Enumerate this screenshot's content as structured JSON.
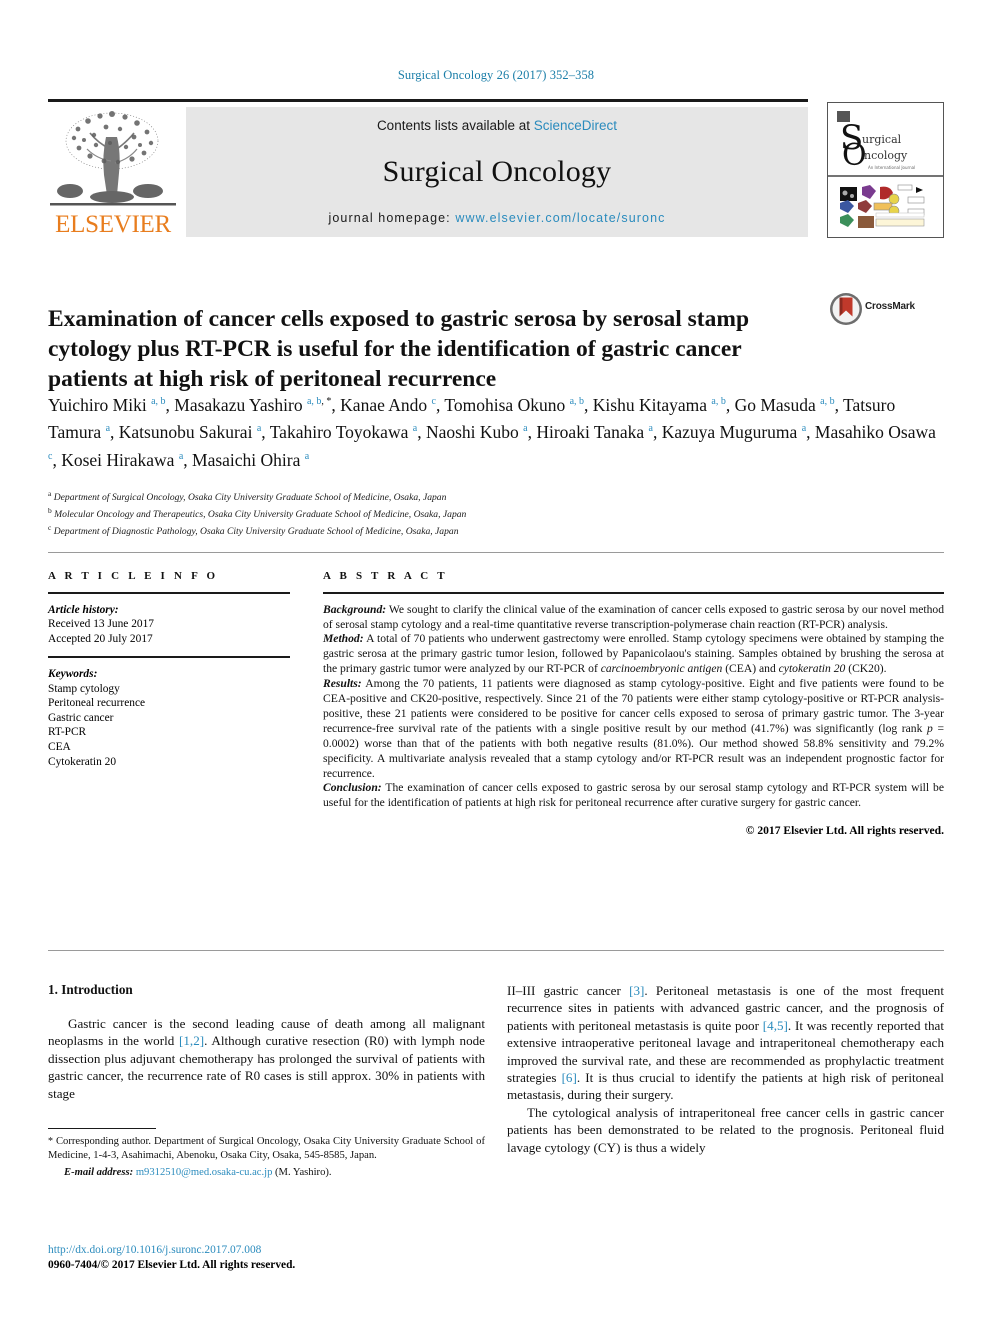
{
  "running_head": "Surgical Oncology 26 (2017) 352–358",
  "banner": {
    "publisher_name": "ELSEVIER",
    "contents_prefix": "Contents lists available at ",
    "contents_link": "ScienceDirect",
    "journal_name": "Surgical Oncology",
    "homepage_prefix": "journal homepage: ",
    "homepage_url": "www.elsevier.com/locate/suronc",
    "cover_alt": "journal-cover-thumbnail"
  },
  "article": {
    "title": "Examination of cancer cells exposed to gastric serosa by serosal stamp cytology plus RT-PCR is useful for the identification of gastric cancer patients at high risk of peritoneal recurrence",
    "crossmark_label": "CrossMark",
    "authors_html": "Yuichiro Miki <sup class=\"aff-mark\">a, b</sup>, Masakazu Yashiro <sup class=\"aff-mark\">a, b</sup><sup class=\"star-mark\">, *</sup>, Kanae Ando <sup class=\"aff-mark\">c</sup>, Tomohisa Okuno <sup class=\"aff-mark\">a, b</sup>, Kishu Kitayama <sup class=\"aff-mark\">a, b</sup>, Go Masuda <sup class=\"aff-mark\">a, b</sup>, Tatsuro Tamura <sup class=\"aff-mark\">a</sup>, Katsunobu Sakurai <sup class=\"aff-mark\">a</sup>, Takahiro Toyokawa <sup class=\"aff-mark\">a</sup>, Naoshi Kubo <sup class=\"aff-mark\">a</sup>, Hiroaki Tanaka <sup class=\"aff-mark\">a</sup>, Kazuya Muguruma <sup class=\"aff-mark\">a</sup>, Masahiko Osawa <sup class=\"aff-mark\">c</sup>, Kosei Hirakawa <sup class=\"aff-mark\">a</sup>, Masaichi Ohira <sup class=\"aff-mark\">a</sup>",
    "affiliations": [
      {
        "mark": "a",
        "text": "Department of Surgical Oncology, Osaka City University Graduate School of Medicine, Osaka, Japan"
      },
      {
        "mark": "b",
        "text": "Molecular Oncology and Therapeutics, Osaka City University Graduate School of Medicine, Osaka, Japan"
      },
      {
        "mark": "c",
        "text": "Department of Diagnostic Pathology, Osaka City University Graduate School of Medicine, Osaka, Japan"
      }
    ]
  },
  "article_info": {
    "heading": "A R T I C L E   I N F O",
    "history_label": "Article history:",
    "received": "Received 13 June 2017",
    "accepted": "Accepted 20 July 2017",
    "keywords_label": "Keywords:",
    "keywords": [
      "Stamp cytology",
      "Peritoneal recurrence",
      "Gastric cancer",
      "RT-PCR",
      "CEA",
      "Cytokeratin 20"
    ]
  },
  "abstract": {
    "heading": "A B S T R A C T",
    "sections": [
      {
        "label": "Background:",
        "html": "<span class=\"abs-lead\">Background:</span> We sought to clarify the clinical value of the examination of cancer cells exposed to gastric serosa by our novel method of serosal stamp cytology and a real-time quantitative reverse transcription-polymerase chain reaction (RT-PCR) analysis."
      },
      {
        "label": "Method:",
        "html": "<span class=\"abs-lead\">Method:</span> A total of 70 patients who underwent gastrectomy were enrolled. Stamp cytology specimens were obtained by stamping the gastric serosa at the primary gastric tumor lesion, followed by Papanicolaou's staining. Samples obtained by brushing the serosa at the primary gastric tumor were analyzed by our RT-PCR of <span class=\"abs-em\">carcinoembryonic antigen</span> (CEA) and <span class=\"abs-em\">cytokeratin 20</span> (CK20)."
      },
      {
        "label": "Results:",
        "html": "<span class=\"abs-lead\">Results:</span> Among the 70 patients, 11 patients were diagnosed as stamp cytology-positive. Eight and five patients were found to be CEA-positive and CK20-positive, respectively. Since 21 of the 70 patients were either stamp cytology-positive or RT-PCR analysis-positive, these 21 patients were considered to be positive for cancer cells exposed to serosa of primary gastric tumor. The 3-year recurrence-free survival rate of the patients with a single positive result by our method (41.7%) was significantly (log rank <span class=\"abs-em\">p</span> = 0.0002) worse than that of the patients with both negative results (81.0%). Our method showed 58.8% sensitivity and 79.2% specificity. A multivariate analysis revealed that a stamp cytology and/or RT-PCR result was an independent prognostic factor for recurrence."
      },
      {
        "label": "Conclusion:",
        "html": "<span class=\"abs-lead\">Conclusion:</span> The examination of cancer cells exposed to gastric serosa by our serosal stamp cytology and RT-PCR system will be useful for the identification of patients at high risk for peritoneal recurrence after curative surgery for gastric cancer."
      }
    ],
    "copyright": "© 2017 Elsevier Ltd. All rights reserved."
  },
  "body": {
    "section_heading": "1. Introduction",
    "left_paragraph_html": "Gastric cancer is the second leading cause of death among all malignant neoplasms in the world <span class=\"ref\">[1,2]</span>. Although curative resection (R0) with lymph node dissection plus adjuvant chemotherapy has prolonged the survival of patients with gastric cancer, the recurrence rate of R0 cases is still approx. 30% in patients with stage",
    "right_paragraph_1_html": "II–III gastric cancer <span class=\"ref\">[3]</span>. Peritoneal metastasis is one of the most frequent recurrence sites in patients with advanced gastric cancer, and the prognosis of patients with peritoneal metastasis is quite poor <span class=\"ref\">[4,5]</span>. It was recently reported that extensive intraoperative peritoneal lavage and intraperitoneal chemotherapy each improved the survival rate, and these are recommended as prophylactic treatment strategies <span class=\"ref\">[6]</span>. It is thus crucial to identify the patients at high risk of peritoneal metastasis, during their surgery.",
    "right_paragraph_2_html": "The cytological analysis of intraperitoneal free cancer cells in gastric cancer patients has been demonstrated to be related to the prognosis. Peritoneal fluid lavage cytology (CY) is thus a widely"
  },
  "footnote": {
    "html": "<span class=\"fn-star\">*</span> Corresponding author. Department of Surgical Oncology, Osaka City University Graduate School of Medicine, 1-4-3, Asahimachi, Abenoku, Osaka City, Osaka, 545-8585, Japan.",
    "email_label": "E-mail address:",
    "email": "m9312510@med.osaka-cu.ac.jp",
    "email_suffix": "(M. Yashiro)."
  },
  "footer": {
    "doi": "http://dx.doi.org/10.1016/j.suronc.2017.07.008",
    "issn_line": "0960-7404/© 2017 Elsevier Ltd. All rights reserved."
  },
  "colors": {
    "link": "#2a8bbd",
    "elsevier_orange": "#e87d1e",
    "banner_gray": "#e6e6e6"
  }
}
